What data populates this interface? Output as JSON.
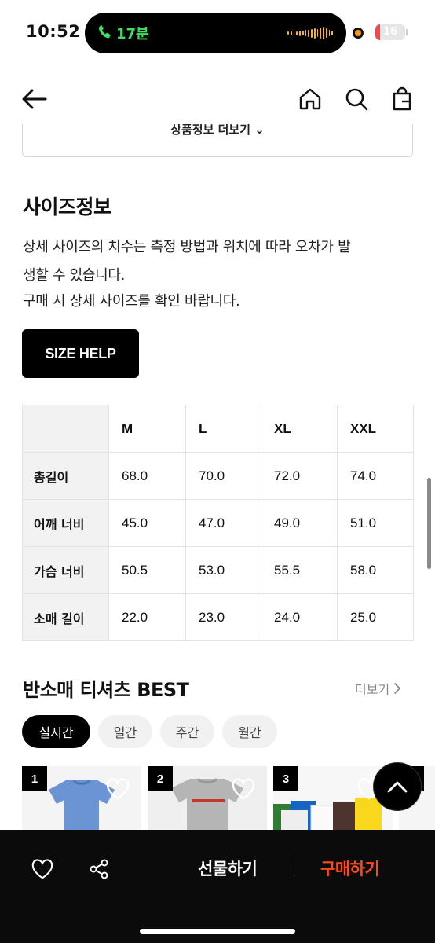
{
  "status_bar": {
    "time": "10:52",
    "call_duration": "17분",
    "battery_level": "16",
    "battery_fraction": 0.16
  },
  "nav": {
    "back_icon": "arrow-left-icon",
    "home_icon": "home-icon",
    "search_icon": "search-icon",
    "bag_icon": "shopping-bag-icon"
  },
  "partial_button": {
    "label": "상품정보 더보기 ⌄"
  },
  "size_info": {
    "title": "사이즈정보",
    "desc_lines": [
      "상세 사이즈의 치수는 측정 방법과 위치에 따라 오차가 발",
      "생할 수 있습니다.",
      "구매 시 상세 사이즈를 확인 바랍니다."
    ],
    "help_button": "SIZE HELP",
    "table": {
      "columns": [
        "M",
        "L",
        "XL",
        "XXL"
      ],
      "rows": [
        {
          "label": "총길이",
          "values": [
            "68.0",
            "70.0",
            "72.0",
            "74.0"
          ]
        },
        {
          "label": "어깨 너비",
          "values": [
            "45.0",
            "47.0",
            "49.0",
            "51.0"
          ]
        },
        {
          "label": "가슴 너비",
          "values": [
            "50.5",
            "53.0",
            "55.5",
            "58.0"
          ]
        },
        {
          "label": "소매 길이",
          "values": [
            "22.0",
            "23.0",
            "24.0",
            "25.0"
          ]
        }
      ]
    }
  },
  "best": {
    "title": "반소매 티셔츠 BEST",
    "more_label": "더보기",
    "tabs": [
      "실시간",
      "일간",
      "주간",
      "월간"
    ],
    "active_tab": 0,
    "products": [
      {
        "rank": "1",
        "color": "#6a94d4"
      },
      {
        "rank": "2",
        "color": "#b5b5b5"
      },
      {
        "rank": "3",
        "color": "#2e7d32"
      }
    ]
  },
  "bottom_bar": {
    "wishlist_icon": "heart-icon",
    "share_icon": "share-icon",
    "gift_label": "선물하기",
    "buy_label": "구매하기",
    "buy_color": "#ff4a1c"
  }
}
